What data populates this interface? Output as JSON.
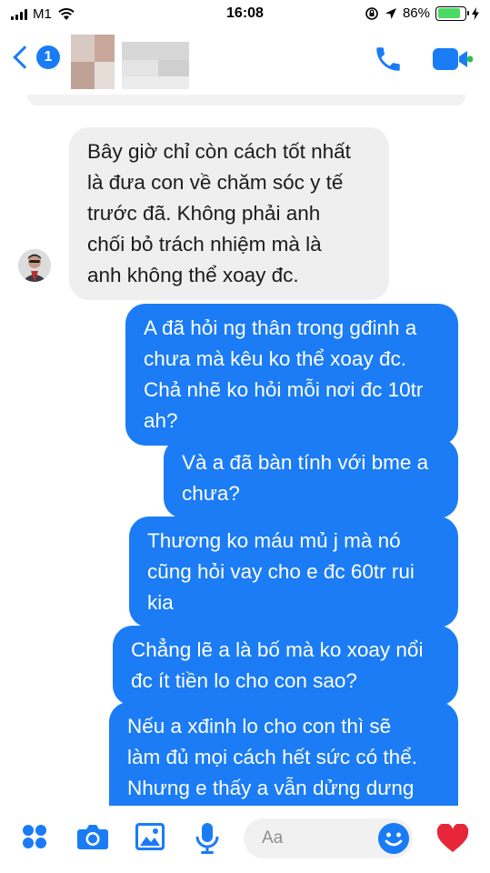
{
  "status_bar": {
    "carrier": "M1",
    "time": "16:08",
    "battery_percent": "86%",
    "battery_level": 0.86
  },
  "header": {
    "back_badge_count": "1",
    "contact_name_blurred": true,
    "accent_color": "#1a7cf5"
  },
  "messages": [
    {
      "direction": "incoming",
      "lines": [
        "Bây giờ chỉ còn cách tốt nhất",
        "là đưa con về chăm sóc y tế",
        "trước đã. Không phải anh",
        "chối bỏ trách nhiệm mà là",
        "anh không thể xoay đc."
      ]
    },
    {
      "direction": "outgoing",
      "lines": [
        "A đã hỏi ng thân trong gđinh a",
        "chưa mà kêu ko thể xoay đc.",
        "Chả nhẽ ko hỏi mỗi nơi đc 10tr",
        "ah?"
      ]
    },
    {
      "direction": "outgoing",
      "lines": [
        "Và a đã bàn tính với bme a",
        "chưa?"
      ]
    },
    {
      "direction": "outgoing",
      "lines": [
        "Thương ko máu mủ j mà nó",
        "cũng hỏi vay cho e đc 60tr rui",
        "kia"
      ]
    },
    {
      "direction": "outgoing",
      "lines": [
        "Chẳng lẽ a là bố mà ko xoay nổi",
        "đc ít tiền lo cho con sao?"
      ]
    },
    {
      "direction": "outgoing",
      "lines": [
        "Nếu a xđinh lo cho con thì sẽ",
        "làm đủ mọi cách hết sức có thể.",
        "Nhưng e thấy a vẫn dửng dưng"
      ]
    }
  ],
  "composer": {
    "placeholder": "Aa",
    "tools": [
      "apps-icon",
      "camera-icon",
      "gallery-icon",
      "microphone-icon"
    ],
    "emoji": "smiley-icon",
    "like": "heart-icon"
  },
  "colors": {
    "outgoing_bubble": "#1b7cf5",
    "incoming_bubble": "#efefef",
    "heart": "#e8263a"
  }
}
